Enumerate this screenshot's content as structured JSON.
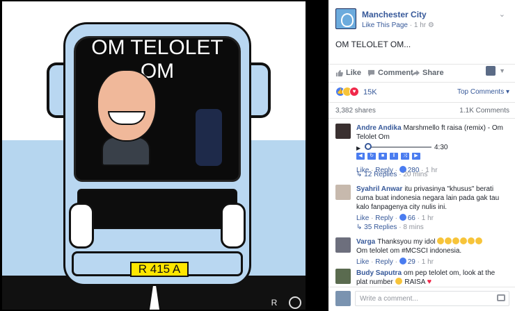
{
  "image": {
    "bus_sign": "OM TELOLET OM",
    "plate": "R 415 A",
    "watermark_letter": "R"
  },
  "post": {
    "page_name": "Manchester City",
    "like_page": "Like This Page",
    "dot": "·",
    "time": "1 hr",
    "globe": "⚙",
    "chevron": "⌄",
    "text": "OM TELOLET OM...",
    "actions": {
      "like": "Like",
      "comment": "Comment",
      "share": "Share"
    },
    "reaction_count": "15K",
    "top_comments": "Top Comments ▾",
    "shares": "3,382 shares",
    "comments_count": "1.1K Comments"
  },
  "comments": [
    {
      "name": "Andre Andika",
      "text": "Marshmello ft raisa (remix) - Om Telolet Om",
      "duration": "4:30",
      "like": "Like",
      "reply": "Reply",
      "likes": "280",
      "time": "1 hr",
      "replies": "12 Replies",
      "replies_time": "20 mins",
      "avatar_color": "#3a3030"
    },
    {
      "name": "Syahril Anwar",
      "text": "itu privasinya \"khusus\" berati cuma buat indonesia negara lain pada gak tau kalo fanpagenya city nulis ini.",
      "like": "Like",
      "reply": "Reply",
      "likes": "66",
      "time": "1 hr",
      "replies": "35 Replies",
      "replies_time": "8 mins",
      "avatar_color": "#c7b9ad"
    },
    {
      "name": "Varga",
      "text": "Thanksyou my idol",
      "text2": "Om telolet om #MCSCI indonesia.",
      "like": "Like",
      "reply": "Reply",
      "likes": "29",
      "time": "1 hr",
      "avatar_color": "#6d6f7d"
    },
    {
      "name": "Budy Saputra",
      "text": "om pep telolet om, look at the plat number",
      "suffix": "RAISA",
      "avatar_color": "#5a6b4f"
    }
  ],
  "writer": {
    "placeholder": "Write a comment..."
  },
  "colors": {
    "link": "#365899",
    "bus": "#b9d7f1",
    "plate": "#ffe600"
  }
}
